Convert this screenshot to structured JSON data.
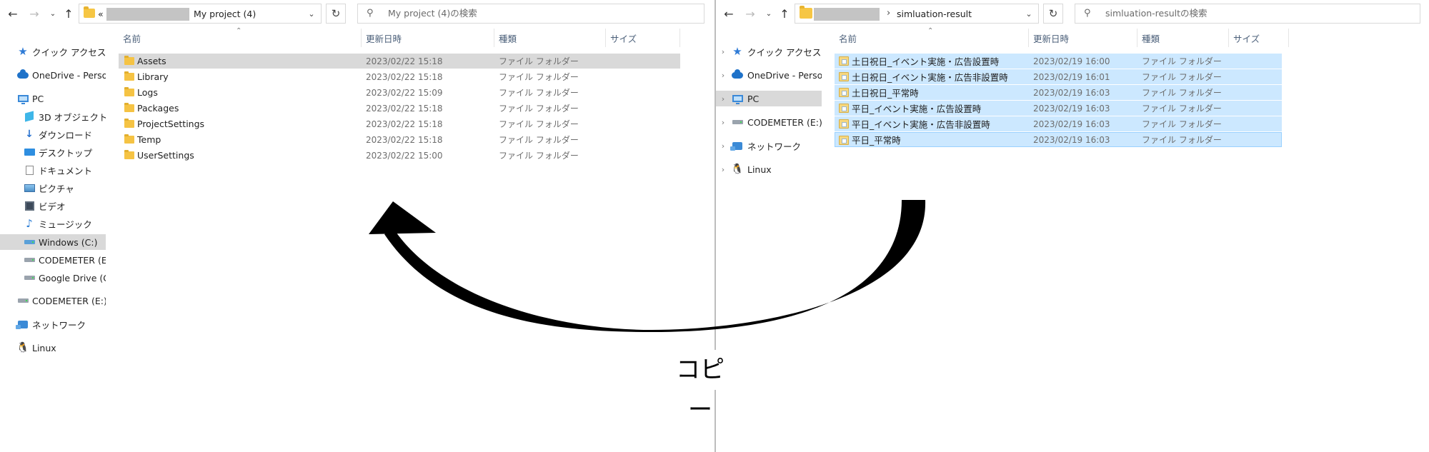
{
  "left_window": {
    "address": {
      "overflow": "«",
      "current_folder": "My project (4)"
    },
    "search_placeholder": "My project (4)の検索",
    "nav": [
      {
        "label": "クイック アクセス",
        "icon": "star-icon"
      },
      {
        "label": "OneDrive - Persona",
        "icon": "cloud-icon"
      },
      {
        "label": "PC",
        "icon": "pc-icon"
      },
      {
        "label": "3D オブジェクト",
        "icon": "cube-icon"
      },
      {
        "label": "ダウンロード",
        "icon": "download-icon"
      },
      {
        "label": "デスクトップ",
        "icon": "desktop-icon"
      },
      {
        "label": "ドキュメント",
        "icon": "document-icon"
      },
      {
        "label": "ピクチャ",
        "icon": "picture-icon"
      },
      {
        "label": "ビデオ",
        "icon": "video-icon"
      },
      {
        "label": "ミュージック",
        "icon": "music-icon"
      },
      {
        "label": "Windows (C:)",
        "icon": "windows-drive-icon",
        "selected": true
      },
      {
        "label": "CODEMETER (E:)",
        "icon": "drive-icon"
      },
      {
        "label": "Google Drive (G:)",
        "icon": "drive-icon"
      },
      {
        "label": "CODEMETER (E:)",
        "icon": "drive-icon"
      },
      {
        "label": "ネットワーク",
        "icon": "network-icon"
      },
      {
        "label": "Linux",
        "icon": "linux-icon"
      }
    ],
    "columns": [
      "名前",
      "更新日時",
      "種類",
      "サイズ"
    ],
    "files": [
      {
        "name": "Assets",
        "modified": "2023/02/22 15:18",
        "type": "ファイル フォルダー",
        "selected": true
      },
      {
        "name": "Library",
        "modified": "2023/02/22 15:18",
        "type": "ファイル フォルダー"
      },
      {
        "name": "Logs",
        "modified": "2023/02/22 15:09",
        "type": "ファイル フォルダー"
      },
      {
        "name": "Packages",
        "modified": "2023/02/22 15:18",
        "type": "ファイル フォルダー"
      },
      {
        "name": "ProjectSettings",
        "modified": "2023/02/22 15:18",
        "type": "ファイル フォルダー"
      },
      {
        "name": "Temp",
        "modified": "2023/02/22 15:18",
        "type": "ファイル フォルダー"
      },
      {
        "name": "UserSettings",
        "modified": "2023/02/22 15:00",
        "type": "ファイル フォルダー"
      }
    ]
  },
  "right_window": {
    "address": {
      "separator": "›",
      "current_folder": "simluation-result"
    },
    "search_placeholder": "simluation-resultの検索",
    "nav": [
      {
        "label": "クイック アクセス",
        "icon": "star-icon"
      },
      {
        "label": "OneDrive - Persona",
        "icon": "cloud-icon"
      },
      {
        "label": "PC",
        "icon": "pc-icon",
        "selected": true
      },
      {
        "label": "CODEMETER (E:)",
        "icon": "drive-icon"
      },
      {
        "label": "ネットワーク",
        "icon": "network-icon"
      },
      {
        "label": "Linux",
        "icon": "linux-icon"
      }
    ],
    "columns": [
      "名前",
      "更新日時",
      "種類",
      "サイズ"
    ],
    "files": [
      {
        "name": "土日祝日_イベント実施・広告設置時",
        "modified": "2023/02/19 16:00",
        "type": "ファイル フォルダー"
      },
      {
        "name": "土日祝日_イベント実施・広告非設置時",
        "modified": "2023/02/19 16:01",
        "type": "ファイル フォルダー"
      },
      {
        "name": "土日祝日_平常時",
        "modified": "2023/02/19 16:03",
        "type": "ファイル フォルダー"
      },
      {
        "name": "平日_イベント実施・広告設置時",
        "modified": "2023/02/19 16:03",
        "type": "ファイル フォルダー"
      },
      {
        "name": "平日_イベント実施・広告非設置時",
        "modified": "2023/02/19 16:03",
        "type": "ファイル フォルダー"
      },
      {
        "name": "平日_平常時",
        "modified": "2023/02/19 16:03",
        "type": "ファイル フォルダー",
        "focused": true
      }
    ]
  },
  "annotation": {
    "label": "コピー"
  },
  "colors": {
    "selection_blue": "#cce8ff",
    "selection_gray": "#d9d9d9",
    "folder_yellow": "#f5c344",
    "accent": "#0078d7"
  }
}
